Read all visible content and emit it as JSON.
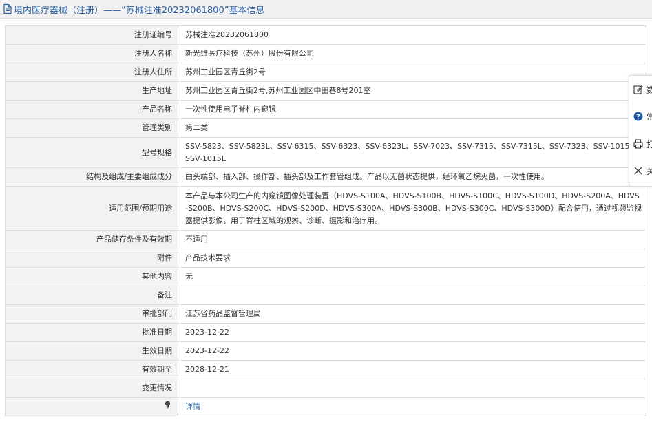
{
  "header": {
    "title": "境内医疗器械（注册）——“苏械注准20232061800”基本信息"
  },
  "rows": [
    {
      "label": "注册证编号",
      "value": "苏械注准20232061800"
    },
    {
      "label": "注册人名称",
      "value": "新光维医疗科技（苏州）股份有限公司"
    },
    {
      "label": "注册人住所",
      "value": "苏州工业园区青丘街2号"
    },
    {
      "label": "生产地址",
      "value": "苏州工业园区青丘街2号,苏州工业园区中田巷8号201室"
    },
    {
      "label": "产品名称",
      "value": "一次性使用电子脊柱内窥镜"
    },
    {
      "label": "管理类别",
      "value": "第二类"
    },
    {
      "label": "型号规格",
      "value": "SSV-5823、SSV-5823L、SSV-6315、SSV-6323、SSV-6323L、SSV-7023、SSV-7315、SSV-7315L、SSV-7323、SSV-1015、SSV-1015L"
    },
    {
      "label": "结构及组成/主要组成成分",
      "value": "由头端部、插入部、操作部、插头部及工作套管组成。产品以无菌状态提供，经环氧乙烷灭菌，一次性使用。"
    },
    {
      "label": "适用范围/预期用途",
      "value": "本产品与本公司生产的内窥镜图像处理装置（HDVS-S100A、HDVS-S100B、HDVS-S100C、HDVS-S100D、HDVS-S200A、HDVS-S200B、HDVS-S200C、HDVS-S200D、HDVS-S300A、HDVS-S300B、HDVS-S300C、HDVS-S300D）配合使用，通过视频监视器提供影像，用于脊柱区域的观察、诊断、摄影和治疗用。"
    },
    {
      "label": "产品储存条件及有效期",
      "value": "不适用"
    },
    {
      "label": "附件",
      "value": "产品技术要求"
    },
    {
      "label": "其他内容",
      "value": "无"
    },
    {
      "label": "备注",
      "value": ""
    },
    {
      "label": "审批部门",
      "value": "江苏省药品监督管理局"
    },
    {
      "label": "批准日期",
      "value": "2023-12-22"
    },
    {
      "label": "生效日期",
      "value": "2023-12-22"
    },
    {
      "label": "有效期至",
      "value": "2028-12-21"
    },
    {
      "label": "变更情况",
      "value": ""
    }
  ],
  "detail": {
    "label": "",
    "link": "详情"
  },
  "side_panel": {
    "items": [
      {
        "icon": "edit-icon",
        "label": "数"
      },
      {
        "icon": "help-icon",
        "label": "常"
      },
      {
        "icon": "print-icon",
        "label": "打"
      },
      {
        "icon": "close-icon",
        "label": "关"
      }
    ]
  },
  "colors": {
    "accent": "#2b63a8",
    "label_bg": "#f2f2f2",
    "border": "#dcdcdc"
  }
}
